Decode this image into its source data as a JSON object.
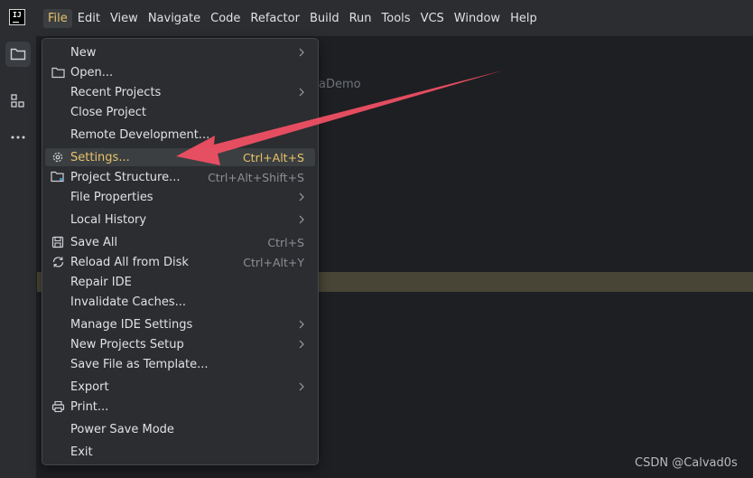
{
  "menubar": {
    "items": [
      "File",
      "Edit",
      "View",
      "Navigate",
      "Code",
      "Refactor",
      "Build",
      "Run",
      "Tools",
      "VCS",
      "Window",
      "Help"
    ],
    "active_item": "File"
  },
  "editor": {
    "hint_text": "aDemo"
  },
  "file_menu": {
    "items": [
      {
        "label": "New",
        "shortcut": "",
        "submenu": true,
        "icon": ""
      },
      {
        "label": "Open...",
        "shortcut": "",
        "submenu": false,
        "icon": "folder-icon"
      },
      {
        "label": "Recent Projects",
        "shortcut": "",
        "submenu": true,
        "icon": ""
      },
      {
        "label": "Close Project",
        "shortcut": "",
        "submenu": false,
        "icon": ""
      },
      {
        "label": "Remote Development...",
        "shortcut": "",
        "submenu": false,
        "icon": ""
      },
      {
        "label": "Settings...",
        "shortcut": "Ctrl+Alt+S",
        "submenu": false,
        "icon": "gear-icon",
        "selected": true
      },
      {
        "label": "Project Structure...",
        "shortcut": "Ctrl+Alt+Shift+S",
        "submenu": false,
        "icon": "project-structure-icon"
      },
      {
        "label": "File Properties",
        "shortcut": "",
        "submenu": true,
        "icon": ""
      },
      {
        "label": "Local History",
        "shortcut": "",
        "submenu": true,
        "icon": ""
      },
      {
        "label": "Save All",
        "shortcut": "Ctrl+S",
        "submenu": false,
        "icon": "save-icon"
      },
      {
        "label": "Reload All from Disk",
        "shortcut": "Ctrl+Alt+Y",
        "submenu": false,
        "icon": "reload-icon"
      },
      {
        "label": "Repair IDE",
        "shortcut": "",
        "submenu": false,
        "icon": ""
      },
      {
        "label": "Invalidate Caches...",
        "shortcut": "",
        "submenu": false,
        "icon": ""
      },
      {
        "label": "Manage IDE Settings",
        "shortcut": "",
        "submenu": true,
        "icon": ""
      },
      {
        "label": "New Projects Setup",
        "shortcut": "",
        "submenu": true,
        "icon": ""
      },
      {
        "label": "Save File as Template...",
        "shortcut": "",
        "submenu": false,
        "icon": ""
      },
      {
        "label": "Export",
        "shortcut": "",
        "submenu": true,
        "icon": ""
      },
      {
        "label": "Print...",
        "shortcut": "",
        "submenu": false,
        "icon": "print-icon"
      },
      {
        "label": "Power Save Mode",
        "shortcut": "",
        "submenu": false,
        "icon": ""
      },
      {
        "label": "Exit",
        "shortcut": "",
        "submenu": false,
        "icon": ""
      }
    ]
  },
  "watermark": "CSDN @Calvad0s",
  "colors": {
    "background": "#2b2d30",
    "editor": "#1e1f22",
    "selected_text": "#e8c26a",
    "annotation_arrow": "#ef4f64"
  }
}
